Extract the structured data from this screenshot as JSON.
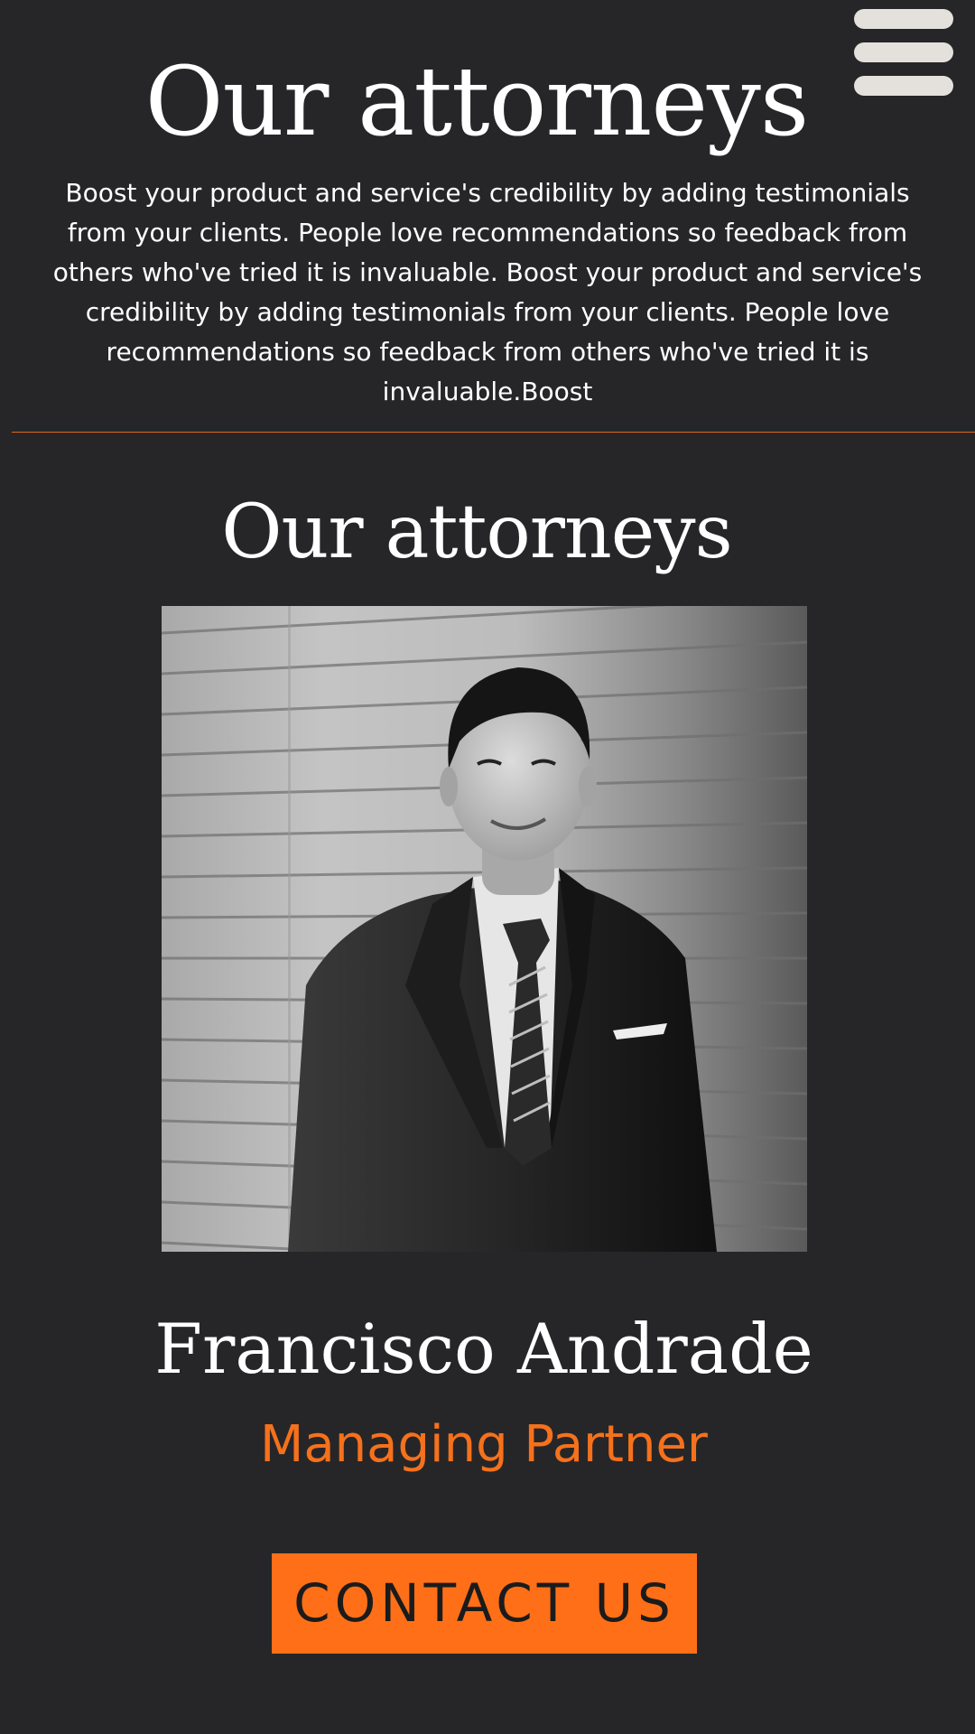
{
  "menu": {
    "icon": "hamburger-menu-icon",
    "color": "#e4e1dc"
  },
  "hero": {
    "title": "Our attorneys",
    "description": "Boost your product and service's credibility by adding testimonials from your clients. People love recommendations so feedback from others who've tried it is invaluable. Boost your product and service's credibility by adding testimonials from your clients. People love recommendations so feedback from others who've tried it is invaluable.Boost"
  },
  "team": {
    "title": "Our attorneys",
    "attorney": {
      "photo_alt": "portrait-photo",
      "name": "Francisco Andrade",
      "role": "Managing Partner"
    },
    "cta_label": "CONTACT US"
  },
  "colors": {
    "background": "#262628",
    "accent": "#ff6f17",
    "divider": "#e0661e",
    "text": "#ffffff"
  }
}
